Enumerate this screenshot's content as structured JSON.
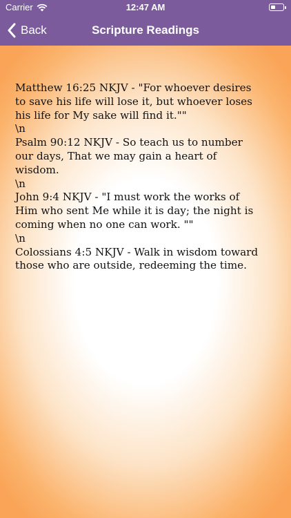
{
  "status_bar": {
    "carrier": "Carrier",
    "time": "12:47 AM",
    "wifi_icon": "wifi-icon",
    "battery_icon": "battery-icon"
  },
  "nav": {
    "back_label": "Back",
    "back_icon": "chevron-left-icon",
    "title": "Scripture Readings"
  },
  "colors": {
    "header": "#7b5b9c",
    "gradient_edge": "#f9a457"
  },
  "content": {
    "text": "Matthew 16:25 NKJV - \"For whoever desires to save his life will lose it, but whoever loses his life for My sake will find it.\"\"\n\\n\nPsalm 90:12 NKJV - So teach us to number our days, That we may gain a heart of wisdom.\n\\n\nJohn 9:4 NKJV - \"I must work the works of Him who sent Me while it is day; the night is coming when no one can work. \"\"\n\\n\nColossians 4:5 NKJV - Walk in wisdom toward those who are outside, redeeming the time."
  }
}
